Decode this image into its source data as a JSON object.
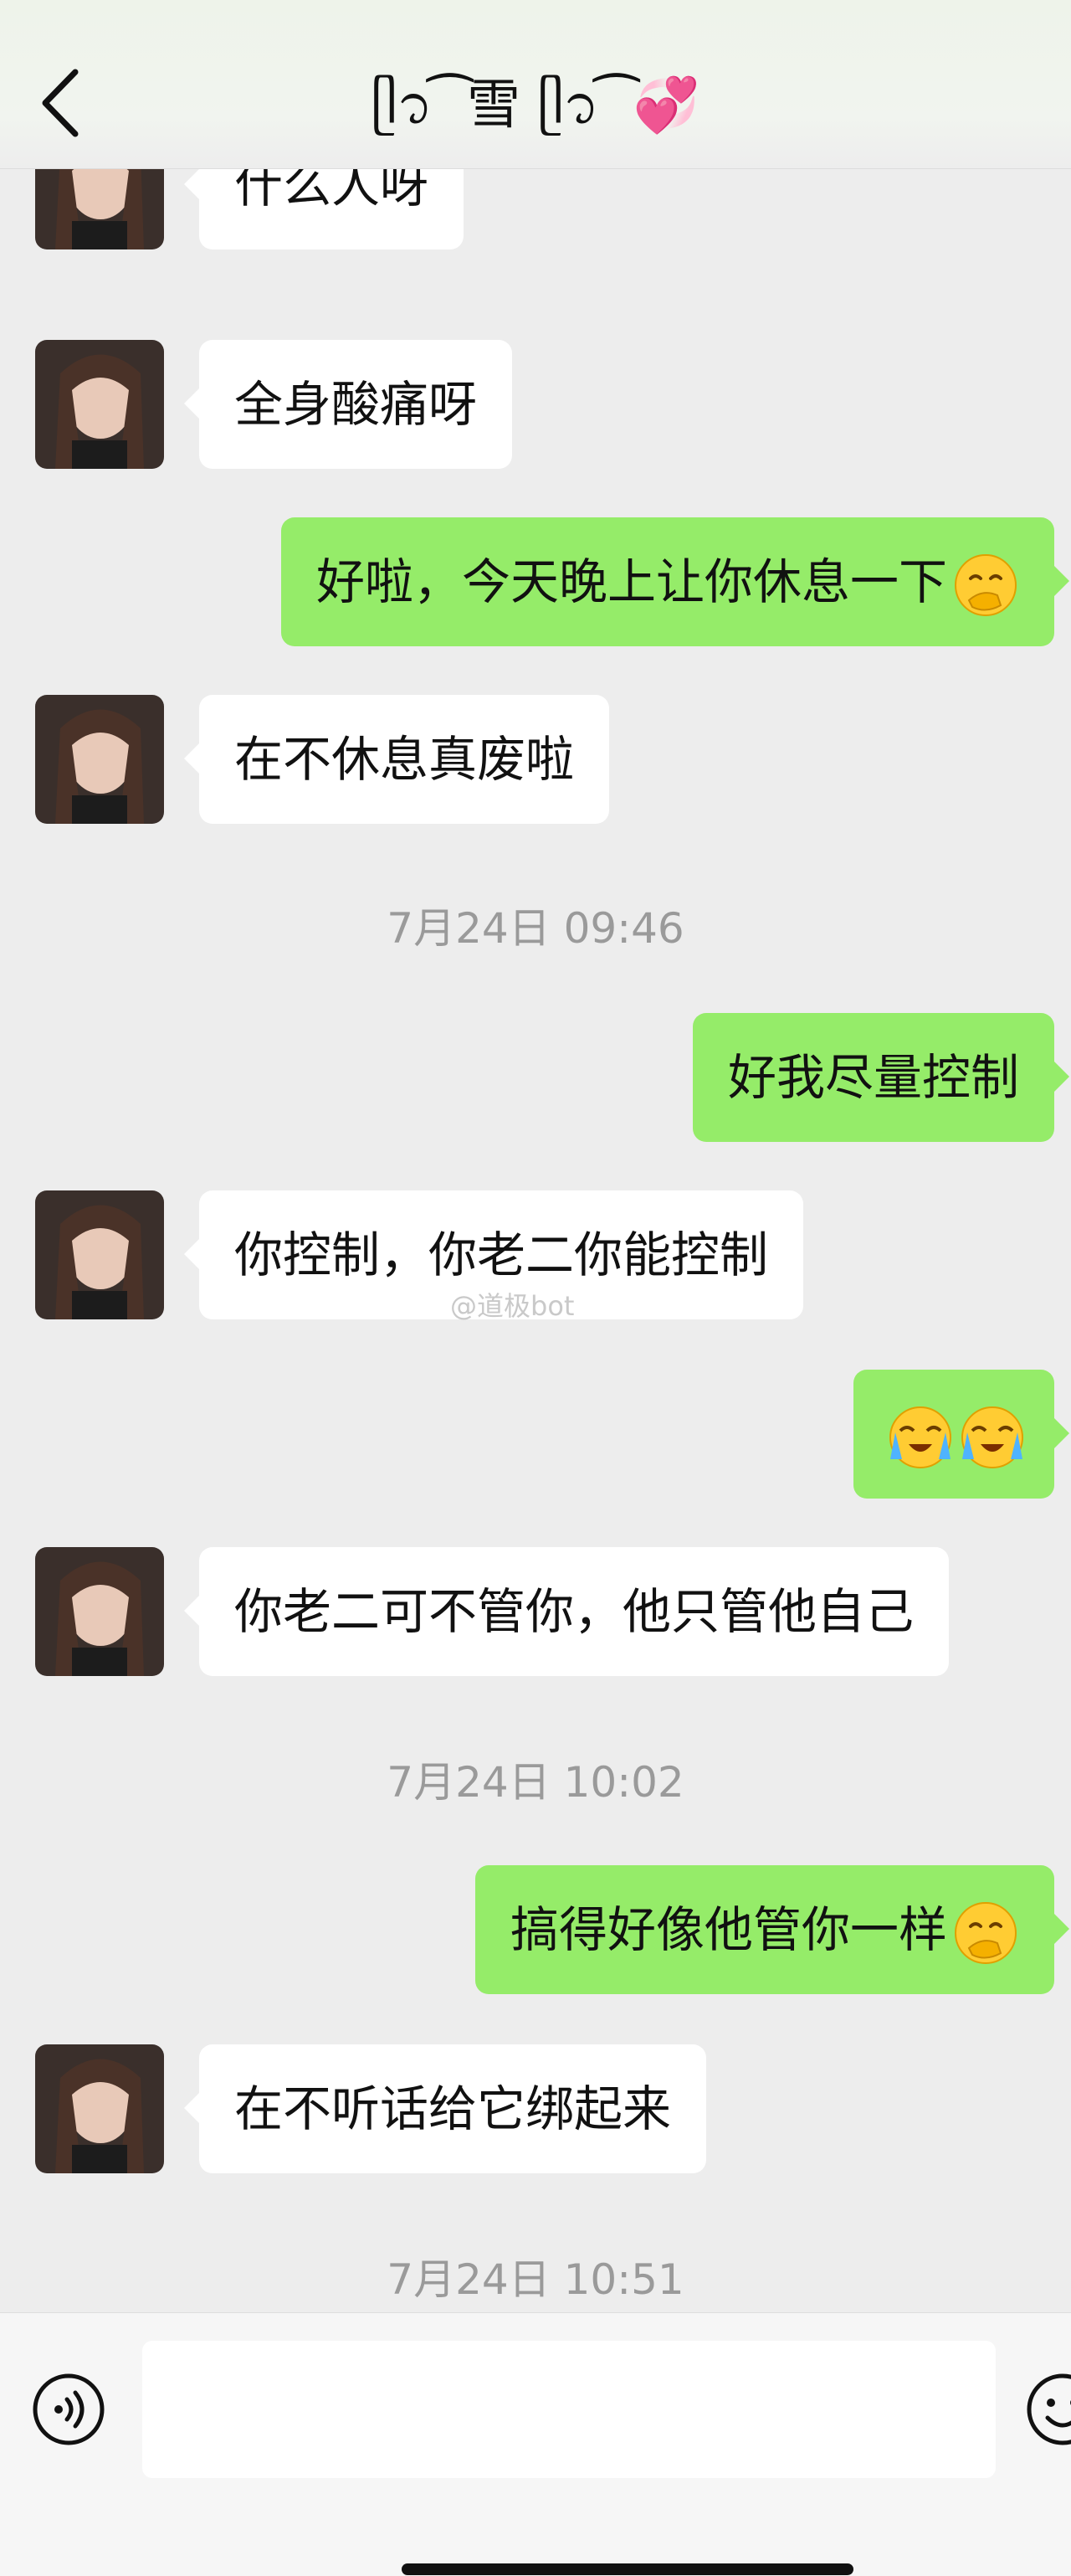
{
  "header": {
    "title": "ᥫ᭡ ͡ 雪 ⁠ᥫ᭡ ͡ 💞",
    "back_icon": "chevron-left-icon"
  },
  "messages": [
    {
      "type": "incoming",
      "text": "什么人呀"
    },
    {
      "type": "incoming",
      "text": "全身酸痛呀"
    },
    {
      "type": "outgoing",
      "text": "好啦，今天晚上让你休息一下",
      "emoji": "hand-over-mouth-emoji"
    },
    {
      "type": "incoming",
      "text": "在不休息真废啦"
    },
    {
      "type": "timestamp",
      "text": "7月24日 09:46"
    },
    {
      "type": "outgoing",
      "text": "好我尽量控制"
    },
    {
      "type": "incoming",
      "text": "你控制，你老二你能控制"
    },
    {
      "type": "outgoing",
      "text": "",
      "emoji": "loudly-crying-face-emoji ×2"
    },
    {
      "type": "incoming",
      "text": "你老二可不管你，他只管他自己"
    },
    {
      "type": "timestamp",
      "text": "7月24日 10:02"
    },
    {
      "type": "outgoing",
      "text": "搞得好像他管你一样",
      "emoji": "hand-over-mouth-emoji"
    },
    {
      "type": "incoming",
      "text": "在不听话给它绑起来"
    },
    {
      "type": "timestamp",
      "text": "7月24日 10:51"
    }
  ],
  "watermark": "@道极bot",
  "input": {
    "value": "",
    "voice_icon": "voice-icon",
    "emoji_icon": "smiley-icon"
  },
  "colors": {
    "outgoing_bubble": "#95ec69",
    "incoming_bubble": "#ffffff",
    "background": "#ededed"
  }
}
